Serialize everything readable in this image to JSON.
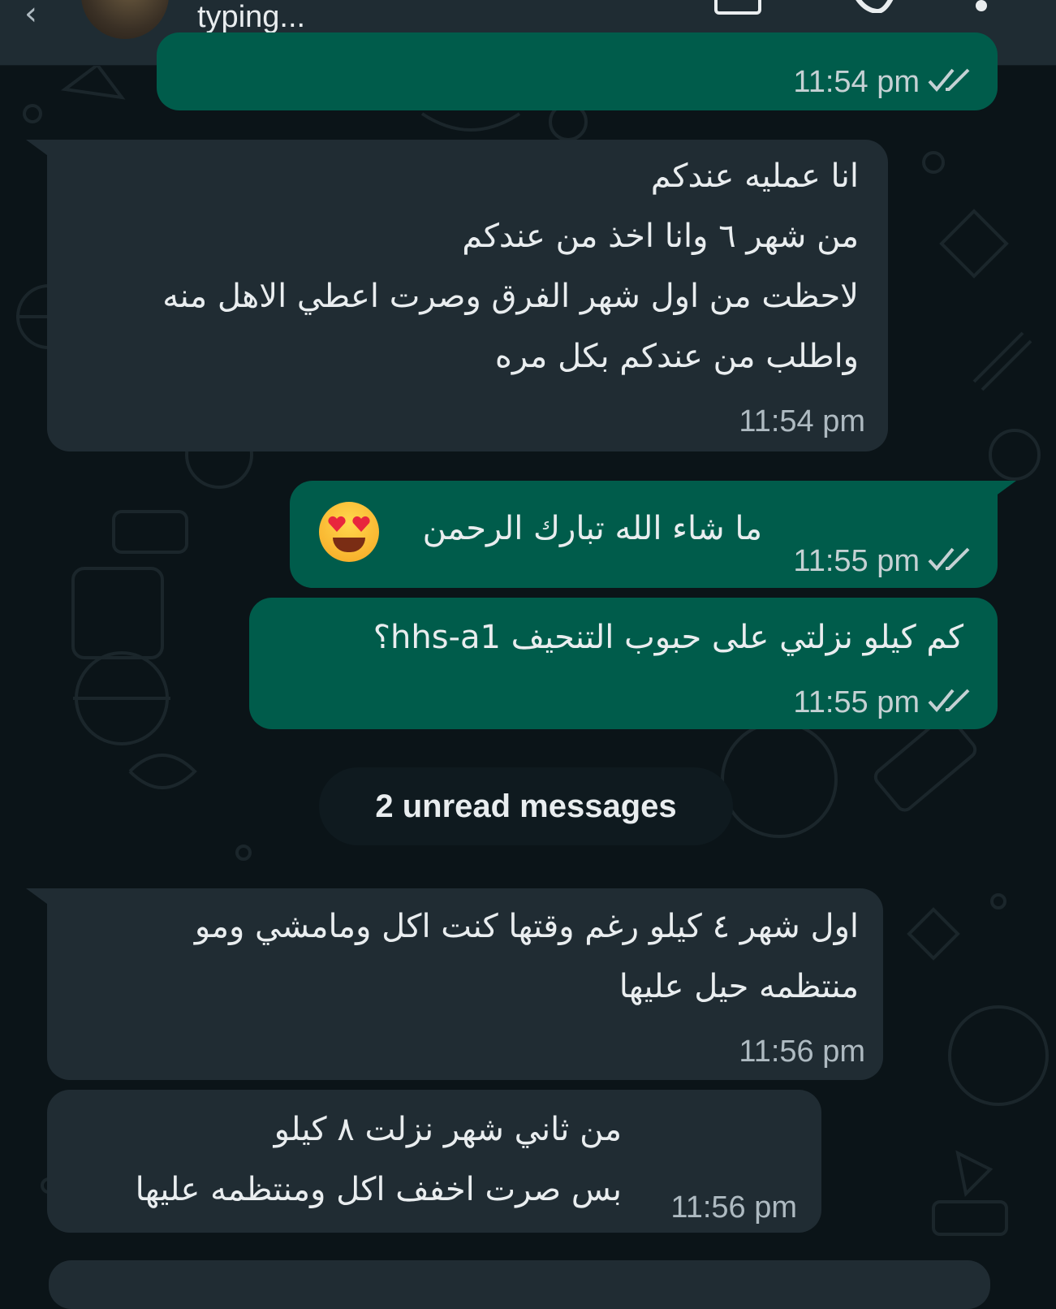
{
  "header": {
    "status": "typing..."
  },
  "messages": [
    {
      "id": "m1",
      "direction": "outgoing",
      "text": "",
      "time": "11:54 pm",
      "read": true
    },
    {
      "id": "m2",
      "direction": "incoming",
      "text": "انا عمليه عندكم\nمن شهر ٦ وانا اخذ من عندكم\nلاحظت من اول شهر الفرق وصرت اعطي الاهل منه\nواطلب من عندكم بكل مره",
      "time": "11:54 pm"
    },
    {
      "id": "m3",
      "direction": "outgoing",
      "text": "ما شاء الله تبارك الرحمن",
      "emoji": "heart-eyes-emoji",
      "time": "11:55 pm",
      "read": true
    },
    {
      "id": "m4",
      "direction": "outgoing",
      "text": "كم كيلو نزلتي على حبوب التنحيف hhs-a1؟",
      "time": "11:55 pm",
      "read": true
    },
    {
      "id": "m5",
      "direction": "incoming",
      "text": "اول شهر ٤ كيلو رغم وقتها كنت اكل ومامشي ومو\nمنتظمه حيل عليها",
      "time": "11:56 pm"
    },
    {
      "id": "m6",
      "direction": "incoming",
      "text": "من ثاني شهر نزلت ٨ كيلو\nبس صرت اخفف اكل ومنتظمه عليها",
      "time": "11:56 pm"
    }
  ],
  "unread_banner": "2 unread messages",
  "colors": {
    "outgoing_bubble": "#005c4b",
    "incoming_bubble": "#202c33",
    "background": "#0b1418",
    "read_ticks": "#c5d1d4"
  }
}
